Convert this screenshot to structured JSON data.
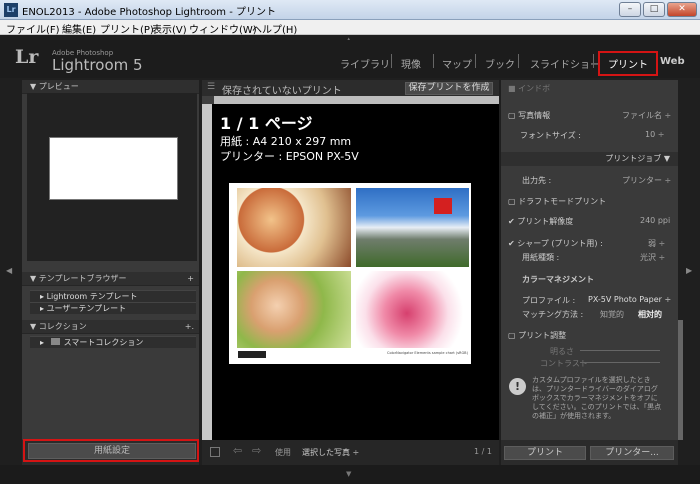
{
  "window": {
    "title": "ENOL2013 - Adobe Photoshop Lightroom - プリント",
    "icon": "Lr",
    "controls": {
      "minimize": "–",
      "maximize": "□",
      "close": "✕"
    }
  },
  "menu": [
    "ファイル(F)",
    "編集(E)",
    "プリント(P)",
    "表示(V)",
    "ウィンドウ(W)",
    "ヘルプ(H)"
  ],
  "identity": {
    "logo": "Lr",
    "sub": "Adobe Photoshop",
    "name": "Lightroom 5"
  },
  "modules": [
    "ライブラリ",
    "現像",
    "マップ",
    "ブック",
    "スライドショー",
    "プリント",
    "Web"
  ],
  "left": {
    "preview": "プレビュー",
    "template_browser": "テンプレートブラウザー",
    "templates": [
      "Lightroom テンプレート",
      "ユーザーテンプレート"
    ],
    "collections": "コレクション",
    "smart": "スマートコレクション",
    "paper_button": "用紙設定"
  },
  "center": {
    "title": "保存されていないプリント",
    "save_button": "保存プリントを作成",
    "page": "1 / 1 ページ",
    "paper": "用紙 : A4 210 x 297 mm",
    "printer": "プリンター : EPSON PX-5V",
    "chart_caption": "ColorNavigator Elements sample chart (sRGB)",
    "toolbar": {
      "use": "使用",
      "selected": "選択した写真 ÷",
      "count": "1 / 1"
    }
  },
  "right": {
    "photo_info": "写真情報",
    "filename": "ファイル名 ÷",
    "font_size": "フォントサイズ :",
    "font_size_val": "10 ÷",
    "print_job": "プリントジョブ",
    "output": "出力先 :",
    "output_val": "プリンター ÷",
    "draft": "ドラフトモードプリント",
    "resolution": "プリント解像度",
    "resolution_val": "240 ppi",
    "sharpen": "シャープ (プリント用) :",
    "sharpen_val": "弱 ÷",
    "media": "用紙種類 :",
    "media_val": "光沢 ÷",
    "color_mgmt": "カラーマネジメント",
    "profile": "プロファイル :",
    "profile_val": "PX-5V Photo Paper ÷",
    "intent": "マッチング方法 :",
    "intent_perceptual": "知覚的",
    "intent_relative": "相対的",
    "adjust": "プリント調整",
    "brightness": "明るさ",
    "contrast": "コントラスト",
    "note": "カスタムプロファイルを選択したときは、プリンタードライバーのダイアログボックスでカラーマネジメントをオフにしてください。このプリントでは、「黒点の補正」が使用されます。",
    "print_btn": "プリント",
    "printer_btn": "プリンター..."
  },
  "colors": {
    "highlight": "#d41414"
  }
}
